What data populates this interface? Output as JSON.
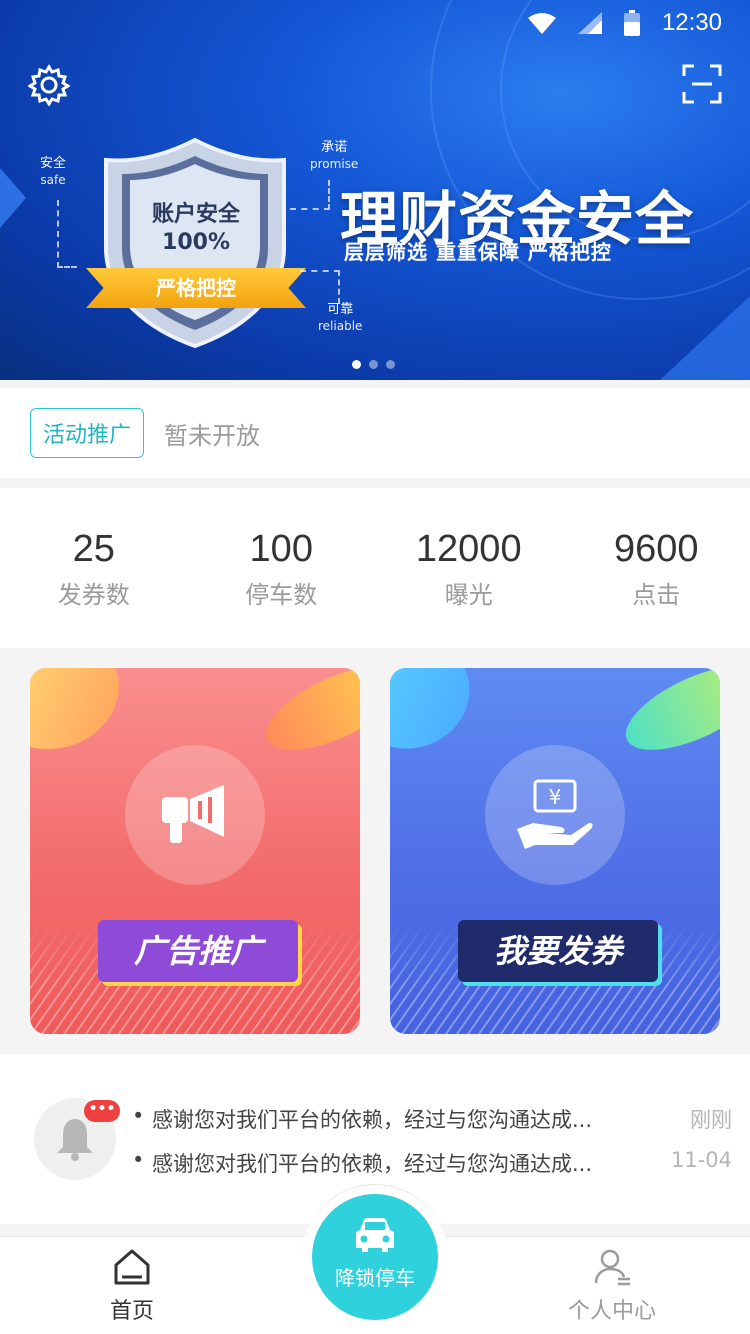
{
  "status_bar": {
    "time": "12:30"
  },
  "banner": {
    "shield_line1": "账户安全",
    "shield_line2": "100%",
    "shield_ribbon": "严格把控",
    "tag_safe": "安全",
    "tag_safe_en": "safe",
    "tag_promise": "承诺",
    "tag_promise_en": "promise",
    "tag_reliable": "可靠",
    "tag_reliable_en": "reliable",
    "headline": "理财资金安全",
    "subline": "层层筛选 重重保障 严格把控",
    "page_count": 3,
    "active_page": 1
  },
  "activity": {
    "badge": "活动推广",
    "note": "暂未开放"
  },
  "stats": [
    {
      "value": "25",
      "label": "发券数"
    },
    {
      "value": "100",
      "label": "停车数"
    },
    {
      "value": "12000",
      "label": "曝光"
    },
    {
      "value": "9600",
      "label": "点击"
    }
  ],
  "cards": {
    "ad": {
      "label": "广告推广",
      "icon": "megaphone-icon"
    },
    "coupon": {
      "label": "我要发券",
      "icon": "coupon-hand-icon"
    }
  },
  "messages": {
    "badge": "•••",
    "items": [
      {
        "text": "感谢您对我们平台的依赖，经过与您沟通达成...",
        "time": "刚刚"
      },
      {
        "text": "感谢您对我们平台的依赖，经过与您沟通达成...",
        "time": "11-04"
      }
    ]
  },
  "tabbar": {
    "home": "首页",
    "center": "降锁停车",
    "me": "个人中心"
  },
  "colors": {
    "accent": "#2ed1dc",
    "banner_blue": "#1457d6",
    "card_red": "#f36c6c",
    "card_blue": "#4f6fe6"
  }
}
